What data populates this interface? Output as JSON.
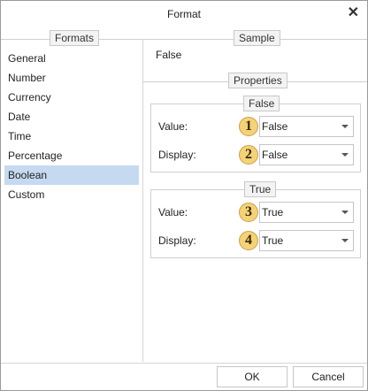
{
  "dialog": {
    "title": "Format"
  },
  "formats": {
    "legend": "Formats",
    "items": [
      "General",
      "Number",
      "Currency",
      "Date",
      "Time",
      "Percentage",
      "Boolean",
      "Custom"
    ],
    "selected": "Boolean"
  },
  "sample": {
    "legend": "Sample",
    "value": "False"
  },
  "properties": {
    "legend": "Properties",
    "false_group": {
      "legend": "False",
      "value_label": "Value:",
      "value_badge": "1",
      "value": "False",
      "display_label": "Display:",
      "display_badge": "2",
      "display": "False"
    },
    "true_group": {
      "legend": "True",
      "value_label": "Value:",
      "value_badge": "3",
      "value": "True",
      "display_label": "Display:",
      "display_badge": "4",
      "display": "True"
    }
  },
  "buttons": {
    "ok": "OK",
    "cancel": "Cancel"
  },
  "icons": {
    "close": "close-icon",
    "dropdown": "chevron-down-icon",
    "badge": "numbered-callout-badge"
  },
  "colors": {
    "selection": "#c5d9f1",
    "badge": "#f4d27a"
  }
}
